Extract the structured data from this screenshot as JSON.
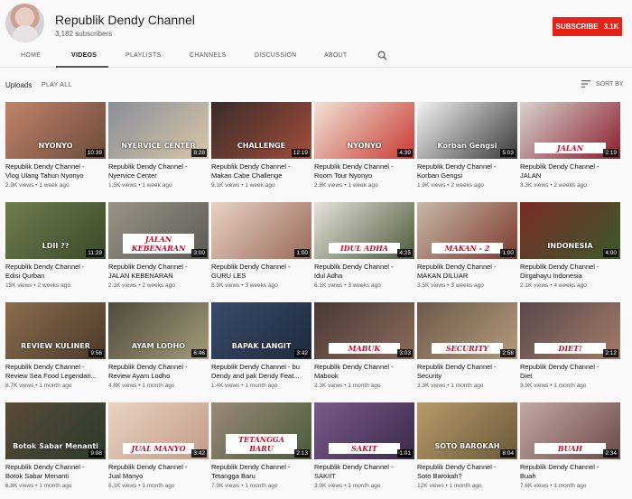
{
  "channel": {
    "name": "Republik Dendy Channel",
    "subscribers": "3,182 subscribers",
    "subscribe_label": "SUBSCRIBE",
    "subscribe_count": "3.1K"
  },
  "tabs": [
    "HOME",
    "VIDEOS",
    "PLAYLISTS",
    "CHANNELS",
    "DISCUSSION",
    "ABOUT"
  ],
  "active_tab": "VIDEOS",
  "uploads": {
    "title": "Uploads",
    "play_all": "PLAY ALL",
    "sort_by": "SORT BY"
  },
  "colors": {
    "subscribe": "#e62117",
    "background": "#f9f9f9"
  },
  "videos": [
    {
      "title1": "Republik Dendy Channel -",
      "title2": "Vlog Ulang Tahun Nyonyo",
      "meta": "2.9K views • 1 week ago",
      "duration": "10:39",
      "label": "NYONYO",
      "thumb": "#c0846a",
      "thumb2": "#6d4a3a",
      "style": "plain"
    },
    {
      "title1": "Republik Dendy Channel -",
      "title2": "Nyervice Center",
      "meta": "1.5K views • 1 week ago",
      "duration": "8:28",
      "label": "NYERVICE CENTER",
      "thumb": "#8a8f98",
      "thumb2": "#d8c6a8",
      "style": "plain"
    },
    {
      "title1": "Republik Dendy Channel -",
      "title2": "Makan Cabe Challenge",
      "meta": "9.1K views • 1 week ago",
      "duration": "12:19",
      "label": "CHALLENGE",
      "thumb": "#3b2b2a",
      "thumb2": "#a24d3a",
      "style": "plain"
    },
    {
      "title1": "Republik Dendy Channel -",
      "title2": "Room Tour Nyonyo",
      "meta": "2.8K views • 1 week ago",
      "duration": "4:39",
      "label": "NYONYO",
      "thumb": "#f1e3d6",
      "thumb2": "#c83a32",
      "style": "plain"
    },
    {
      "title1": "Republik Dendy Channel -",
      "title2": "Korban Gengsi",
      "meta": "1.9K views • 2 weeks ago",
      "duration": "5:03",
      "label": "Korban Gengsi",
      "thumb": "#f3f3f3",
      "thumb2": "#3a3a3a",
      "style": "plain"
    },
    {
      "title1": "Republik Dendy Channel -",
      "title2": "JALAN",
      "meta": "3.3K views • 2 weeks ago",
      "duration": "2:19",
      "label": "JALAN",
      "thumb": "#d7d3cf",
      "thumb2": "#8b1d2c",
      "style": "banner"
    },
    {
      "title1": "Republik Dendy Channel -",
      "title2": "Edisi Qurban",
      "meta": "15K views • 2 weeks ago",
      "duration": "11:29",
      "label": "LDII ??",
      "thumb": "#6f7d4d",
      "thumb2": "#3a4a2a",
      "style": "plain"
    },
    {
      "title1": "Republik Dendy Channel -",
      "title2": "JALAN KEBENARAN",
      "meta": "2.1K views • 2 weeks ago",
      "duration": "3:00",
      "label": "JALAN KEBENARAN",
      "thumb": "#9a9486",
      "thumb2": "#5b5a55",
      "style": "banner"
    },
    {
      "title1": "Republik Dendy Channel -",
      "title2": "GURU LES",
      "meta": "8.5K views • 3 weeks ago",
      "duration": "1:00",
      "label": "",
      "thumb": "#e8d2c4",
      "thumb2": "#9b6a5a",
      "style": "plain"
    },
    {
      "title1": "Republik Dendy Channel -",
      "title2": "Idul Adha",
      "meta": "6.1K views • 3 weeks ago",
      "duration": "4:25",
      "label": "IDUL ADHA",
      "thumb": "#e6e3dc",
      "thumb2": "#4d5a3a",
      "style": "banner"
    },
    {
      "title1": "Republik Dendy Channel -",
      "title2": "MAKAN DILUAR",
      "meta": "3.5K views • 3 weeks ago",
      "duration": "1:00",
      "label": "MAKAN - 2",
      "thumb": "#c8b9a8",
      "thumb2": "#7d3a2d",
      "style": "banner"
    },
    {
      "title1": "Republik Dendy Channel -",
      "title2": "Dirgahayu Indonesia",
      "meta": "2.1K views • 4 weeks ago",
      "duration": "4:00",
      "label": "INDONESIA",
      "thumb": "#7a2c26",
      "thumb2": "#3b5a2a",
      "style": "plain"
    },
    {
      "title1": "Republik Dendy Channel -",
      "title2": "Review Sea Food Legendari...",
      "meta": "8.7K views • 1 month ago",
      "duration": "9:56",
      "label": "REVIEW KULINER",
      "thumb": "#8b6d4d",
      "thumb2": "#4a3a2a",
      "style": "plain"
    },
    {
      "title1": "Republik Dendy Channel -",
      "title2": "Review Ayam Lodho",
      "meta": "4.8K views • 1 month ago",
      "duration": "6:46",
      "label": "AYAM LODHO",
      "thumb": "#4f4a3c",
      "thumb2": "#a39b7a",
      "style": "plain"
    },
    {
      "title1": "Republik Dendy Channel - bu",
      "title2": "Dendy and pak Dendy Feat...",
      "meta": "1.4K views • 1 month ago",
      "duration": "3:42",
      "label": "BAPAK LANGIT",
      "thumb": "#3a4a6a",
      "thumb2": "#1d2a3e",
      "style": "plain"
    },
    {
      "title1": "Republik Dendy Channel -",
      "title2": "Mabook",
      "meta": "2.3K views • 1 month ago",
      "duration": "3:03",
      "label": "MABUK",
      "thumb": "#4a3a36",
      "thumb2": "#8a6a5a",
      "style": "banner"
    },
    {
      "title1": "Republik Dendy Channel -",
      "title2": "Security",
      "meta": "3.3K views • 1 month ago",
      "duration": "2:58",
      "label": "SECURITY",
      "thumb": "#6d5a4a",
      "thumb2": "#b39a7a",
      "style": "banner"
    },
    {
      "title1": "Republik Dendy Channel -",
      "title2": "Diet",
      "meta": "3.9K views • 1 month ago",
      "duration": "2:12",
      "label": "DIET!",
      "thumb": "#5a4a4a",
      "thumb2": "#a27a6a",
      "style": "banner"
    },
    {
      "title1": "Republik Dendy Channel -",
      "title2": "Botok Sabar Menanti",
      "meta": "6.8K views • 1 month ago",
      "duration": "9:08",
      "label": "Botok Sabar Menanti",
      "thumb": "#5a4a3a",
      "thumb2": "#2a3a2a",
      "style": "plain"
    },
    {
      "title1": "Republik Dendy Channel -",
      "title2": "Jual Manyo",
      "meta": "8.1K views • 1 month ago",
      "duration": "3:42",
      "label": "JUAL MANYO",
      "thumb": "#e8d4c4",
      "thumb2": "#c49a86",
      "style": "banner"
    },
    {
      "title1": "Republik Dendy Channel -",
      "title2": "Tetangga Baru",
      "meta": "7.9K views • 1 month ago",
      "duration": "2:13",
      "label": "TETANGGA BARU",
      "thumb": "#9a8a7a",
      "thumb2": "#4a5a3a",
      "style": "banner"
    },
    {
      "title1": "Republik Dendy Channel -",
      "title2": "SAKIIT",
      "meta": "3.9K views • 1 month ago",
      "duration": "1:01",
      "label": "SAKIT",
      "thumb": "#7a5a8a",
      "thumb2": "#3a2a4a",
      "style": "banner"
    },
    {
      "title1": "Republik Dendy Channel -",
      "title2": "Soto Barokah?",
      "meta": "12K views • 1 month ago",
      "duration": "8:04",
      "label": "SOTO BAROKAH",
      "thumb": "#b89a6a",
      "thumb2": "#6a5a3a",
      "style": "plain"
    },
    {
      "title1": "Republik Dendy Channel -",
      "title2": "Buah",
      "meta": "7.6K views • 1 month ago",
      "duration": "2:34",
      "label": "BUAH",
      "thumb": "#c4a8a2",
      "thumb2": "#6a4a4a",
      "style": "banner"
    }
  ]
}
